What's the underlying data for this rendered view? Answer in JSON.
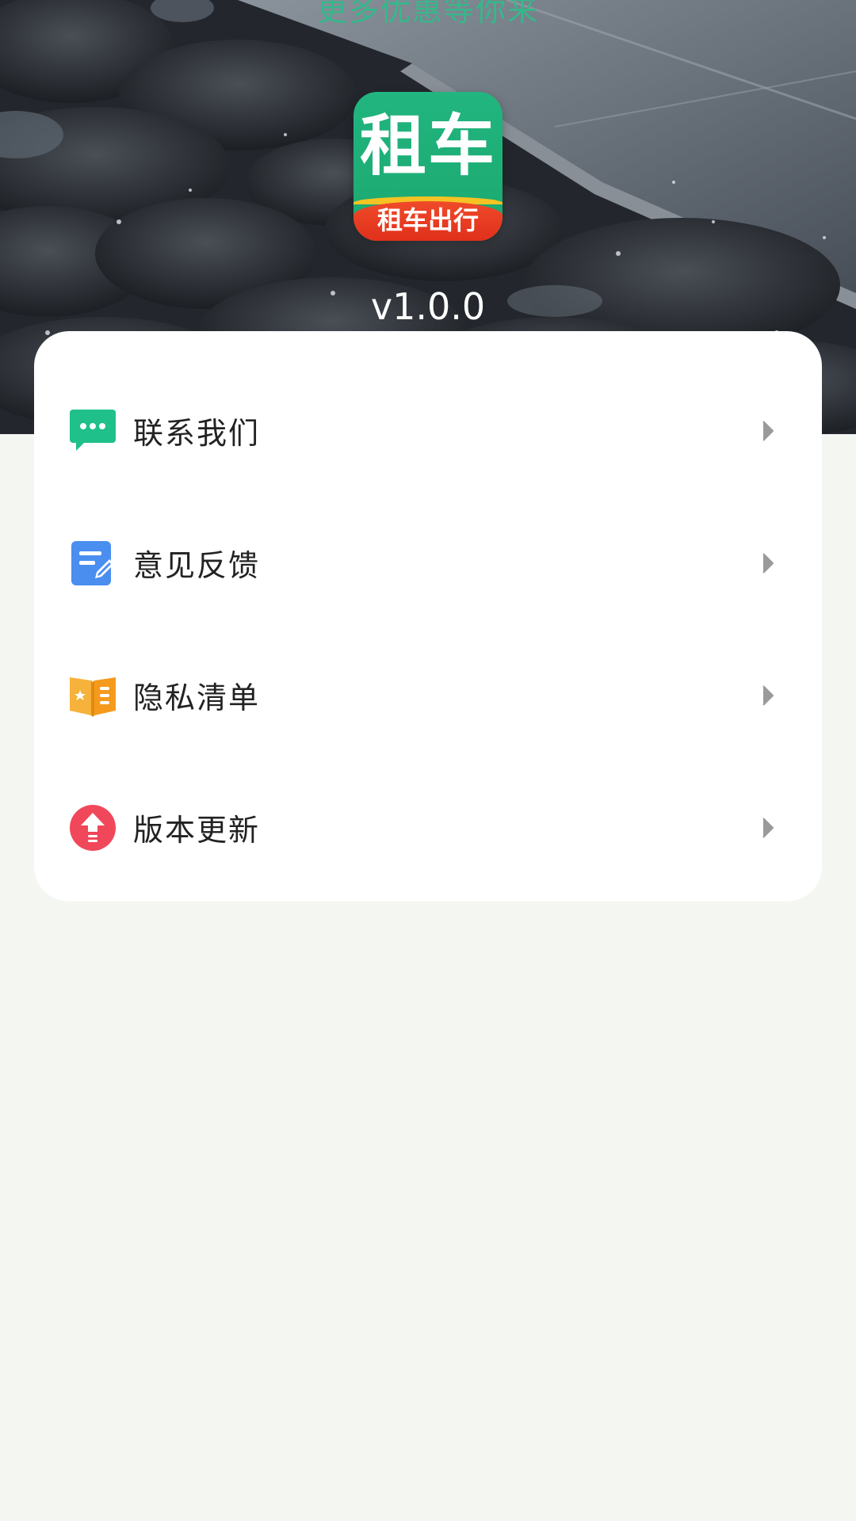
{
  "header": {
    "tagline": "更多优惠等你来",
    "logo_main": "租车",
    "logo_sub": "租车出行",
    "version": "v1.0.0"
  },
  "menu": {
    "items": [
      {
        "label": "联系我们",
        "icon": "chat-icon",
        "icon_color": "#1fc08a"
      },
      {
        "label": "意见反馈",
        "icon": "feedback-edit-icon",
        "icon_color": "#4a8ef0"
      },
      {
        "label": "隐私清单",
        "icon": "privacy-list-icon",
        "icon_color": "#f6a623"
      },
      {
        "label": "版本更新",
        "icon": "upgrade-arrow-icon",
        "icon_color": "#f0485a"
      }
    ]
  }
}
